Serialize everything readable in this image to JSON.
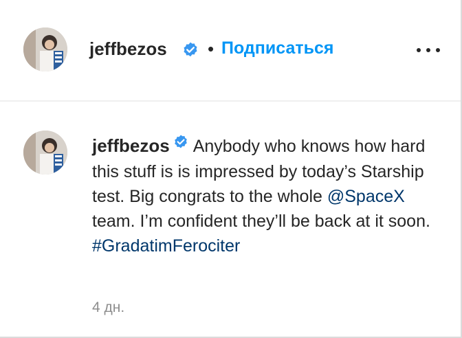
{
  "header": {
    "username": "jeffbezos",
    "separator": "•",
    "follow_label": "Подписаться",
    "more_icon": "more-horizontal-icon"
  },
  "comment": {
    "username": "jeffbezos",
    "text_before_mention": "Anybody who knows how hard this stuff is is impressed by today’s Starship test. Big congrats to the whole ",
    "mention": "@SpaceX",
    "text_after_mention": " team. I’m confident they’ll be back at it soon.",
    "hashtag": "#GradatimFerociter",
    "time": "4 дн."
  },
  "colors": {
    "follow": "#0095f6",
    "link": "#00376b",
    "verified": "#3897f0",
    "muted": "#8e8e8e"
  }
}
